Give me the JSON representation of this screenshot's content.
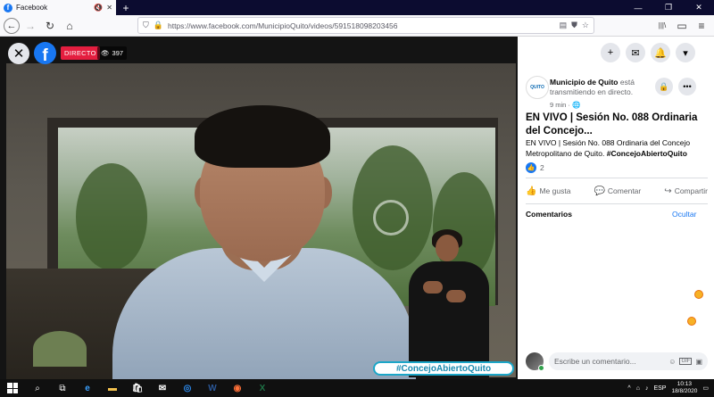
{
  "browser": {
    "tab": {
      "favicon_letter": "f",
      "title": "Facebook",
      "mute_icon": "🔇",
      "close_icon": "✕"
    },
    "newtab_icon": "+",
    "window_controls": {
      "minimize": "—",
      "restore": "❐",
      "close": "✕"
    },
    "nav": {
      "back": "←",
      "forward": "→",
      "reload": "↻",
      "home": "⌂"
    },
    "url": "https://www.facebook.com/MunicipioQuito/videos/591518098203456",
    "right_icons": {
      "library": "|||\\",
      "sidebar": "▭",
      "menu": "≡"
    }
  },
  "video": {
    "close_icon": "✕",
    "fb_letter": "f",
    "live_label": "DIRECTO",
    "views_icon": "👁",
    "views": "397",
    "hashtag": "#ConcejoAbiertoQuito"
  },
  "panel": {
    "top_icons": {
      "create": "+",
      "messenger": "✉",
      "notifications": "🔔",
      "account": "▾"
    },
    "page": {
      "avatar_text": "QUITO",
      "name": "Municipio de Quito",
      "status": " está transmitiendo en directo.",
      "time": "9 min · ",
      "globe": "🌐",
      "save_icon": "🔒",
      "more_icon": "•••"
    },
    "title": "EN VIVO | Sesión No. 088 Ordinaria del Concejo...",
    "description": "EN VIVO | Sesión No. 088 Ordinaria del Concejo Metropolitano de Quito. ",
    "description_tag": "#ConcejoAbiertoQuito",
    "reactions": {
      "icon": "👍",
      "count": "2"
    },
    "actions": {
      "like_icon": "👍",
      "like": "Me gusta",
      "comment_icon": "💬",
      "comment": "Comentar",
      "share_icon": "↪",
      "share": "Compartir"
    },
    "comments_title": "Comentarios",
    "hide_label": "Ocultar",
    "comment_placeholder": "Escribe un comentario...",
    "comment_icons": {
      "emoji": "☺",
      "gif": "GIF",
      "sticker": "▣"
    }
  },
  "taskbar": {
    "search": "⌕",
    "taskview": "⧉",
    "apps": [
      {
        "name": "edge",
        "glyph": "e",
        "color": "#3aa0ff"
      },
      {
        "name": "explorer",
        "glyph": "▬",
        "color": "#f2c14e"
      },
      {
        "name": "store",
        "glyph": "🛍",
        "color": "#ffffff"
      },
      {
        "name": "mail",
        "glyph": "✉",
        "color": "#ffffff"
      },
      {
        "name": "browser",
        "glyph": "◎",
        "color": "#2d8cf0"
      },
      {
        "name": "word",
        "glyph": "W",
        "color": "#2b5797"
      },
      {
        "name": "firefox",
        "glyph": "◉",
        "color": "#ff7139"
      },
      {
        "name": "excel",
        "glyph": "X",
        "color": "#1e7145"
      }
    ],
    "tray": {
      "up": "^",
      "network": "⌂",
      "volume": "♪",
      "language": "ESP",
      "time": "10:13",
      "date": "18/8/2020",
      "notifications": "▭"
    }
  }
}
